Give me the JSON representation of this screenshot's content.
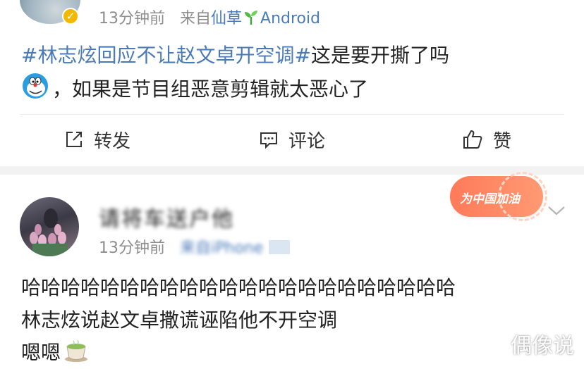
{
  "post": {
    "time": "13分钟前",
    "source_prefix": "来自",
    "source": "仙草",
    "source_suffix": "Android",
    "hashtag": "#林志炫回应不让赵文卓开空调#",
    "text_line1": "这是要开撕了吗",
    "text_line2": "，如果是节目组恶意剪辑就太恶心了"
  },
  "actions": {
    "repost": "转发",
    "comment": "评论",
    "like": "赞"
  },
  "comment": {
    "username": "请将车送户他",
    "badge_label": "为中国加油",
    "time": "13分钟前",
    "source_prefix": "来自",
    "source": "iPhone",
    "line1": "哈哈哈哈哈哈哈哈哈哈哈哈哈哈哈哈哈哈哈哈哈哈",
    "line2": "林志炫说赵文卓撒谎诬陷他不开空调",
    "line3": "嗯嗯"
  },
  "watermark": "偶像说",
  "colors": {
    "link": "#4a7bb7",
    "meta": "#8d8d8d",
    "verified_badge": "#f5b800",
    "badge_bg": "#ff7a59"
  },
  "icons": [
    "verified-icon",
    "sprout-icon",
    "doraemon-emoji",
    "repost-icon",
    "comment-icon",
    "like-icon",
    "chevron-down-icon",
    "tea-emoji"
  ]
}
